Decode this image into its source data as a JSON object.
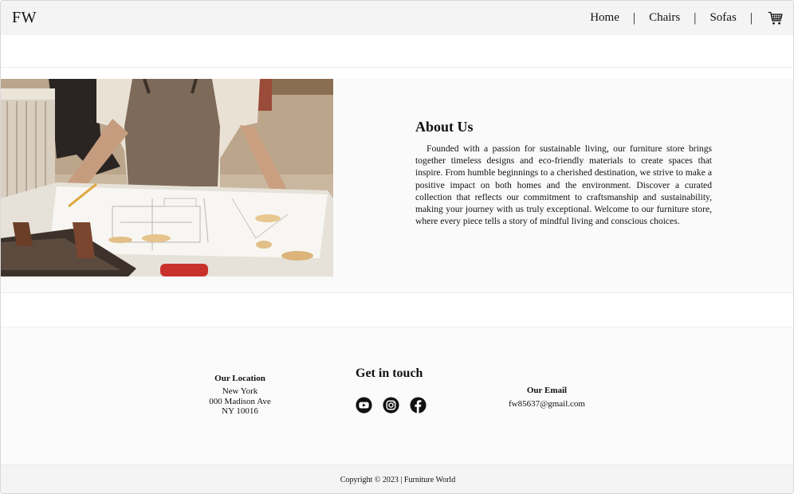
{
  "navbar": {
    "logo": "FW",
    "links": [
      {
        "label": "Home"
      },
      {
        "label": "Chairs"
      },
      {
        "label": "Sofas"
      }
    ],
    "separator": "|",
    "cart_icon": "shopping-cart-icon"
  },
  "about": {
    "image_subject": "carpenter-workbench-blueprint-photo",
    "title": "About Us",
    "body": "Founded with a passion for sustainable living, our furniture store brings together timeless designs and eco-friendly materials to create spaces that inspire. From humble beginnings to a cherished destination, we strive to make a positive impact on both homes and the environment. Discover a curated collection that reflects our commitment to craftsmanship and sustainability, making your journey with us truly exceptional. Welcome to our furniture store, where every piece tells a story of mindful living and conscious choices."
  },
  "footer": {
    "location": {
      "title": "Our Location",
      "city": "New York",
      "street": "000 Madison Ave",
      "zip": "NY 10016"
    },
    "get_in_touch": {
      "title": "Get in touch",
      "icons": [
        "youtube-icon",
        "instagram-icon",
        "facebook-icon"
      ]
    },
    "email": {
      "title": "Our Email",
      "address": "fw85637@gmail.com"
    },
    "copyright": "Copyright © 2023 | Furniture World"
  }
}
